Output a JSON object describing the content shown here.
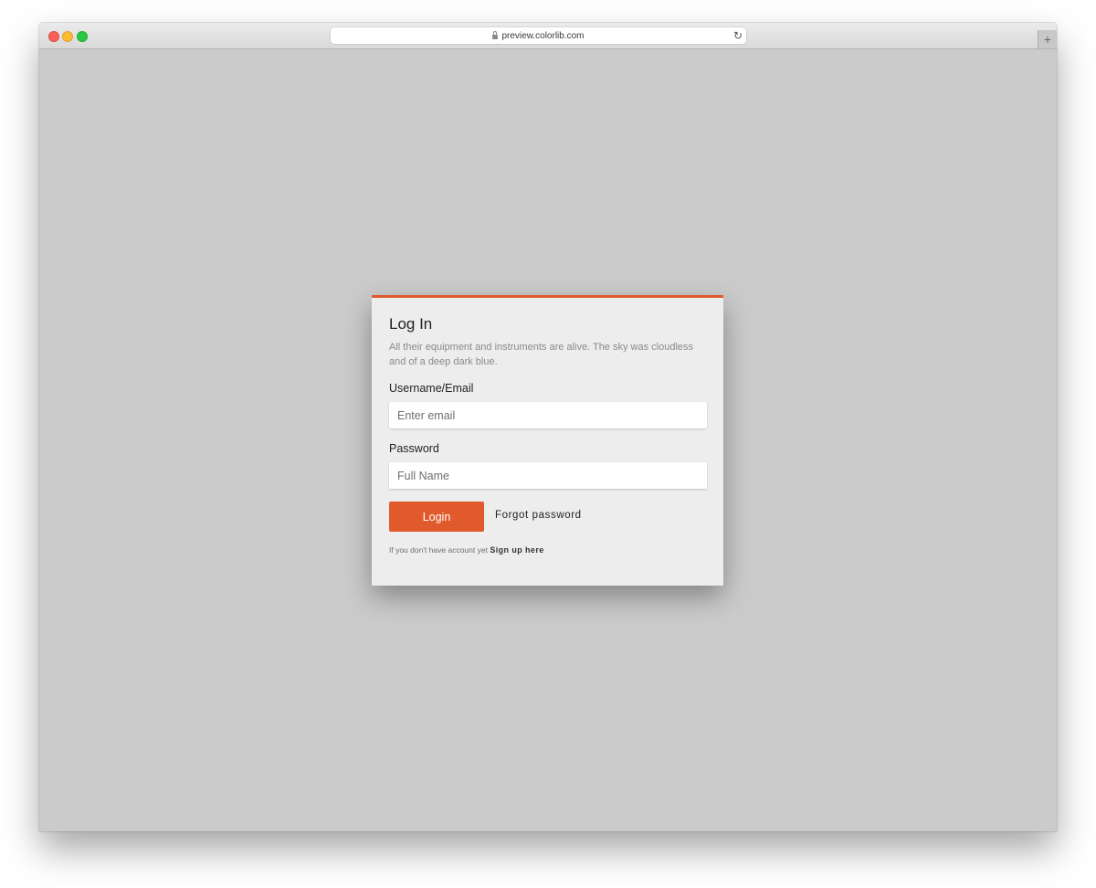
{
  "browser": {
    "url": "preview.colorlib.com",
    "new_tab_symbol": "+",
    "reload_symbol": "↻"
  },
  "login_card": {
    "title": "Log In",
    "description": "All their equipment and instruments are alive. The sky was cloudless and of a deep dark blue.",
    "username_label": "Username/Email",
    "username_placeholder": "Enter email",
    "password_label": "Password",
    "password_placeholder": "Full Name",
    "login_button": "Login",
    "forgot_link": "Forgot password",
    "signup_prompt": "If you don't have account yet",
    "signup_link": "Sign up here"
  },
  "colors": {
    "accent": "#e05a2b",
    "page_background": "#cbcbcb",
    "card_background": "#ededed"
  },
  "icons": [
    "lock-icon",
    "reload-icon",
    "new-tab-icon"
  ]
}
